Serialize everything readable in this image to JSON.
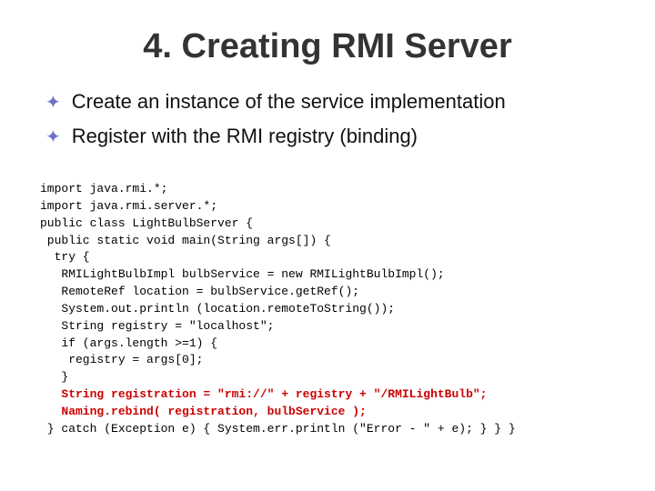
{
  "slide": {
    "title": "4. Creating RMI Server",
    "bullets": [
      {
        "text": "Create an instance of the service implementation"
      },
      {
        "text": "Register with the RMI registry (binding)"
      }
    ],
    "code": {
      "lines": [
        {
          "text": "import java.rmi.*;",
          "highlight": false
        },
        {
          "text": "import java.rmi.server.*;",
          "highlight": false
        },
        {
          "text": "public class LightBulbServer {",
          "highlight": false
        },
        {
          "text": " public static void main(String args[]) {",
          "highlight": false
        },
        {
          "text": "  try {",
          "highlight": false
        },
        {
          "text": "   RMILightBulbImpl bulbService = new RMILightBulbImpl();",
          "highlight": false
        },
        {
          "text": "   RemoteRef location = bulbService.getRef();",
          "highlight": false
        },
        {
          "text": "   System.out.println (location.remoteToString());",
          "highlight": false
        },
        {
          "text": "   String registry = \"localhost\";",
          "highlight": false
        },
        {
          "text": "   if (args.length >=1) {",
          "highlight": false
        },
        {
          "text": "    registry = args[0];",
          "highlight": false
        },
        {
          "text": "   }",
          "highlight": false
        },
        {
          "text": "   String registration = \"rmi://\" + registry + \"/RMILightBulb\";",
          "highlight": true
        },
        {
          "text": "   Naming.rebind( registration, bulbService );",
          "highlight": true
        },
        {
          "text": " } catch (Exception e) { System.err.println (\"Error - \" + e); } } }",
          "highlight": false
        }
      ]
    }
  }
}
